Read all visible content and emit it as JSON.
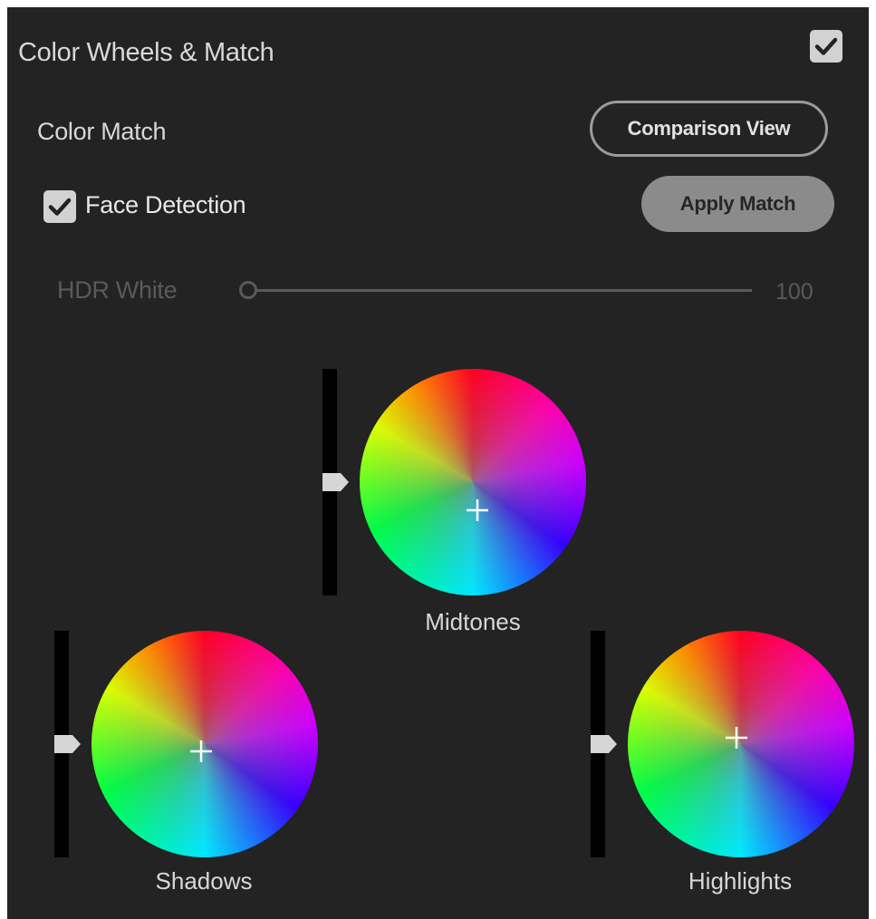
{
  "panel": {
    "title": "Color Wheels & Match",
    "enabled_icon": "checkmark-icon"
  },
  "color_match": {
    "label": "Color Match",
    "comparison_button": "Comparison View",
    "face_detection_label": "Face Detection",
    "face_detection_checked": true,
    "apply_button": "Apply Match"
  },
  "hdr_white": {
    "label": "HDR White",
    "value": "100",
    "disabled": true
  },
  "wheels": {
    "midtones": {
      "label": "Midtones"
    },
    "shadows": {
      "label": "Shadows"
    },
    "highlights": {
      "label": "Highlights"
    }
  },
  "colors": {
    "panel_bg": "#232323",
    "text": "#d8d8d8",
    "disabled_text": "#5a5a5a",
    "button_fill": "#8b8b8b",
    "checkbox_fill": "#d2d2d2"
  }
}
